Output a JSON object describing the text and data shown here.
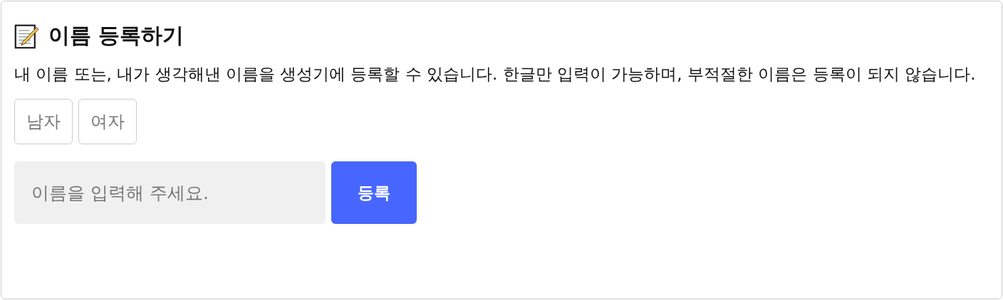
{
  "title": "이름 등록하기",
  "description": "내 이름 또는, 내가 생각해낸 이름을 생성기에 등록할 수 있습니다. 한글만 입력이 가능하며, 부적절한 이름은 등록이 되지 않습니다.",
  "genders": [
    {
      "label": "남자",
      "selected": false
    },
    {
      "label": "여자",
      "selected": false
    }
  ],
  "name_field": {
    "placeholder": "이름을 입력해 주세요."
  },
  "submit_button": "등록"
}
